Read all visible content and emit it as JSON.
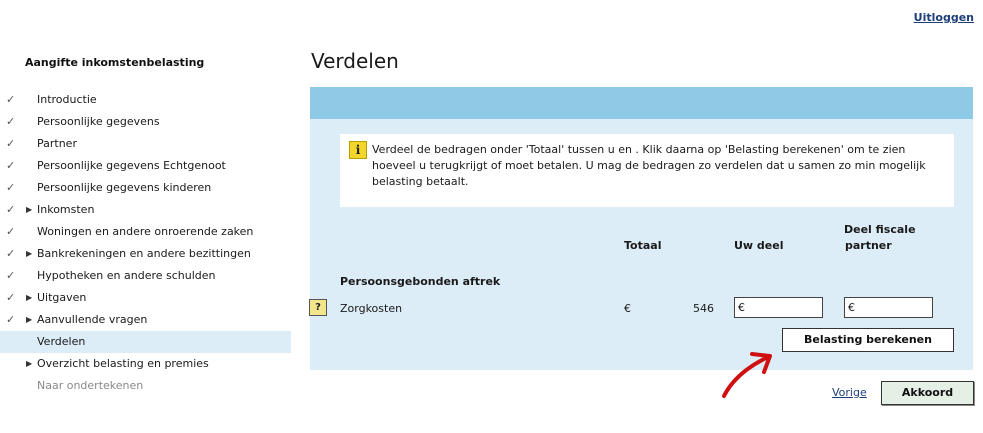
{
  "header": {
    "logout_label": "Uitloggen"
  },
  "sidebar": {
    "title": "Aangifte inkomstenbelasting",
    "items": [
      {
        "label": "Introductie",
        "checked": true,
        "expandable": false,
        "state": "done"
      },
      {
        "label": "Persoonlijke gegevens",
        "checked": true,
        "expandable": false,
        "state": "done"
      },
      {
        "label": "Partner",
        "checked": true,
        "expandable": false,
        "state": "done"
      },
      {
        "label": "Persoonlijke gegevens Echtgenoot",
        "checked": true,
        "expandable": false,
        "state": "done"
      },
      {
        "label": "Persoonlijke gegevens kinderen",
        "checked": true,
        "expandable": false,
        "state": "done"
      },
      {
        "label": "Inkomsten",
        "checked": true,
        "expandable": true,
        "state": "done"
      },
      {
        "label": "Woningen en andere onroerende zaken",
        "checked": true,
        "expandable": false,
        "state": "done"
      },
      {
        "label": "Bankrekeningen en andere bezittingen",
        "checked": true,
        "expandable": true,
        "state": "done"
      },
      {
        "label": "Hypotheken en andere schulden",
        "checked": true,
        "expandable": false,
        "state": "done"
      },
      {
        "label": "Uitgaven",
        "checked": true,
        "expandable": true,
        "state": "done"
      },
      {
        "label": "Aanvullende vragen",
        "checked": true,
        "expandable": true,
        "state": "done"
      },
      {
        "label": "Verdelen",
        "checked": false,
        "expandable": false,
        "state": "active"
      },
      {
        "label": "Overzicht belasting en premies",
        "checked": false,
        "expandable": true,
        "state": "todo"
      },
      {
        "label": "Naar ondertekenen",
        "checked": false,
        "expandable": false,
        "state": "disabled"
      }
    ]
  },
  "main": {
    "title": "Verdelen",
    "info_text": "Verdeel de bedragen onder 'Totaal' tussen u en                  . Klik daarna op 'Belasting berekenen' om te zien hoeveel u terugkrijgt of moet betalen. U mag de bedragen zo verdelen dat u samen zo min mogelijk belasting betaalt.",
    "info_icon": "i",
    "columns": {
      "total": "Totaal",
      "own_share": "Uw deel",
      "partner_line1": "Deel fiscale",
      "partner_line2": "partner"
    },
    "section_label": "Persoonsgebonden aftrek",
    "row": {
      "help": "?",
      "label": "Zorgkosten",
      "currency": "€",
      "total": "546",
      "own_value": "€",
      "partner_value": "€"
    },
    "calc_button": "Belasting berekenen"
  },
  "footer": {
    "prev_label": "Vorige",
    "accept_label": "Akkoord"
  },
  "colors": {
    "panel_bg": "#dcedf8",
    "panel_header": "#8ec9e6",
    "info_icon": "#f3d52c",
    "annotation_arrow": "#d01010"
  }
}
